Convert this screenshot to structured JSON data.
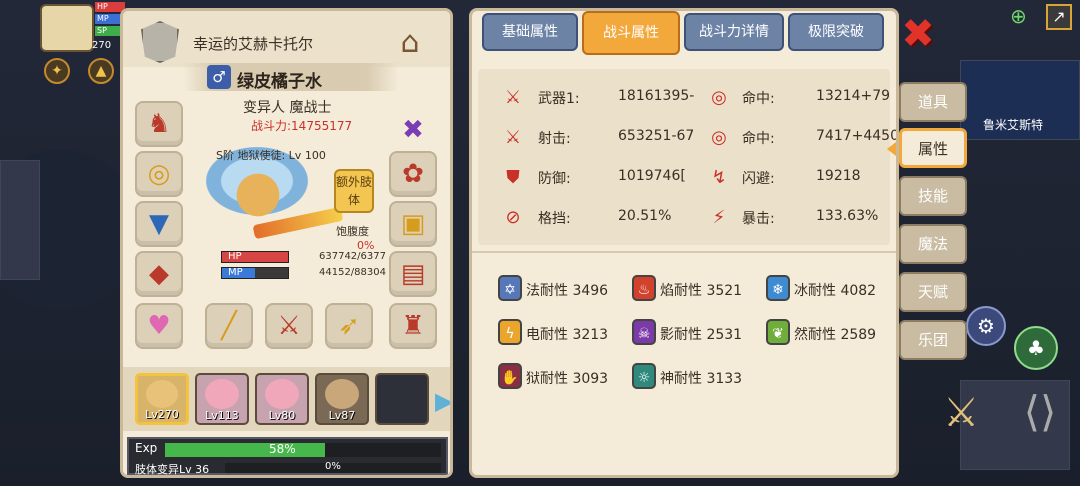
{
  "hud": {
    "level": "270",
    "bar_labels": [
      "HP",
      "MP",
      "SP"
    ]
  },
  "character": {
    "guild_name": "幸运的艾赫卡托尔",
    "name": "绿皮橘子水",
    "gender_symbol": "♂",
    "class": "变异人 魔战士",
    "power_label": "战斗力:",
    "power_value": "14755177",
    "rank_text": "S阶 地狱使徒: Lv 100",
    "extra_body_label": "额外肢体",
    "satiety_label": "饱腹度",
    "satiety_value": "0%",
    "hp_label": "HP",
    "hp_text": "637742/6377",
    "mp_label": "MP",
    "mp_text": "44152/88304",
    "hp_fraction": 1.0,
    "mp_fraction": 0.5
  },
  "party": [
    {
      "level": "Lv270",
      "selected": true
    },
    {
      "level": "Lv113",
      "selected": false
    },
    {
      "level": "Lv80",
      "selected": false
    },
    {
      "level": "Lv87",
      "selected": false
    },
    {
      "level": "",
      "selected": false
    }
  ],
  "exp": {
    "label": "Exp",
    "percent_text": "58%",
    "fraction": 0.58,
    "body_label": "肢体变异Lv 36",
    "body_percent_text": "0%"
  },
  "tabs": [
    "基础属性",
    "战斗属性",
    "战斗力详情",
    "极限突破"
  ],
  "active_tab": 1,
  "stats": [
    {
      "label": "武器1:",
      "value": "18161395-",
      "icon": "sword-icon"
    },
    {
      "label": "命中:",
      "value": "13214+79",
      "icon": "target-icon"
    },
    {
      "label": "射击:",
      "value": "653251-67",
      "icon": "sword-icon"
    },
    {
      "label": "命中:",
      "value": "7417+4450",
      "icon": "target-icon"
    },
    {
      "label": "防御:",
      "value": "1019746[",
      "icon": "shield-icon"
    },
    {
      "label": "闪避:",
      "value": "19218",
      "icon": "dodge-icon"
    },
    {
      "label": "格挡:",
      "value": "20.51%",
      "icon": "block-icon"
    },
    {
      "label": "暴击:",
      "value": "133.63%",
      "icon": "crit-icon"
    }
  ],
  "resistances": [
    {
      "text": "法耐性 3496",
      "color": "#5678b9",
      "icon": "magic-resist-icon"
    },
    {
      "text": "焰耐性 3521",
      "color": "#d2412b",
      "icon": "fire-resist-icon"
    },
    {
      "text": "冰耐性 4082",
      "color": "#3f8bd2",
      "icon": "ice-resist-icon"
    },
    {
      "text": "电耐性 3213",
      "color": "#e9a52c",
      "icon": "lightning-resist-icon"
    },
    {
      "text": "影耐性 2531",
      "color": "#7b3aa8",
      "icon": "shadow-resist-icon"
    },
    {
      "text": "然耐性 2589",
      "color": "#6fae3a",
      "icon": "nature-resist-icon"
    },
    {
      "text": "狱耐性 3093",
      "color": "#8a2e44",
      "icon": "hell-resist-icon"
    },
    {
      "text": "神耐性 3133",
      "color": "#2f8a7c",
      "icon": "divine-resist-icon"
    }
  ],
  "side_tabs": [
    "道具",
    "属性",
    "技能",
    "魔法",
    "天赋",
    "乐团"
  ],
  "active_side_tab": 1,
  "world": {
    "player_label": "鲁米艾斯特"
  }
}
